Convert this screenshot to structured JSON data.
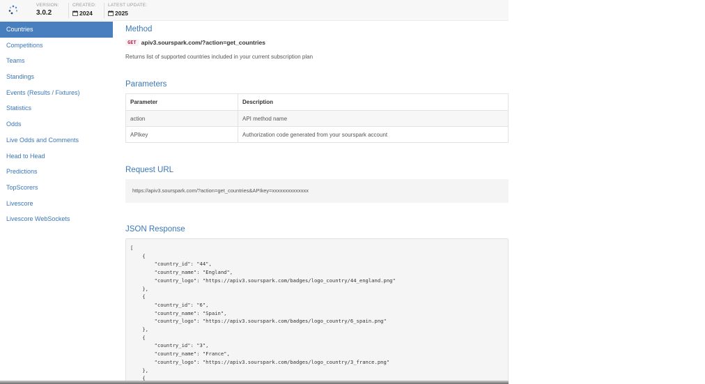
{
  "header": {
    "version_label": "VERSION:",
    "version_value": "3.0.2",
    "created_label": "CREATED:",
    "created_value": "2024",
    "updated_label": "LATEST UPDATE:",
    "updated_value": "2025",
    "logo_icon": "spinner-logo-icon",
    "calendar_icon": "calendar-icon"
  },
  "sidebar": {
    "items": [
      {
        "label": "Countries",
        "active": true
      },
      {
        "label": "Competitions"
      },
      {
        "label": "Teams"
      },
      {
        "label": "Standings"
      },
      {
        "label": "Events (Results / Fixtures)"
      },
      {
        "label": "Statistics"
      },
      {
        "label": "Odds"
      },
      {
        "label": "Live Odds and Comments"
      },
      {
        "label": "Head to Head"
      },
      {
        "label": "Predictions"
      },
      {
        "label": "TopScorers"
      },
      {
        "label": "Livescore"
      },
      {
        "label": "Livescore WebSockets"
      }
    ]
  },
  "main": {
    "method_title": "Method",
    "method_badge": "GET",
    "method_url": "apiv3.sourspark.com/?action=get_countries",
    "method_desc": "Returns list of supported countries included in your current subscription plan",
    "params_title": "Parameters",
    "params_headers": [
      "Parameter",
      "Description"
    ],
    "params_rows": [
      [
        "action",
        "API method name"
      ],
      [
        "APIkey",
        "Authorization code generated from your sourspark account"
      ]
    ],
    "request_title": "Request URL",
    "request_url": "https://apiv3.sourspark.com/?action=get_countries&APIkey=xxxxxxxxxxxxxx",
    "json_title": "JSON Response",
    "json_code": "[\n    {\n        \"country_id\": \"44\",\n        \"country_name\": \"England\",\n        \"country_logo\": \"https://apiv3.sourspark.com/badges/logo_country/44_england.png\"\n    },\n    {\n        \"country_id\": \"6\",\n        \"country_name\": \"Spain\",\n        \"country_logo\": \"https://apiv3.sourspark.com/badges/logo_country/6_spain.png\"\n    },\n    {\n        \"country_id\": \"3\",\n        \"country_name\": \"France\",\n        \"country_logo\": \"https://apiv3.sourspark.com/badges/logo_country/3_france.png\"\n    },\n    {"
  },
  "colors": {
    "accent": "#3b77b8",
    "active_bg": "#4a7fbf"
  }
}
